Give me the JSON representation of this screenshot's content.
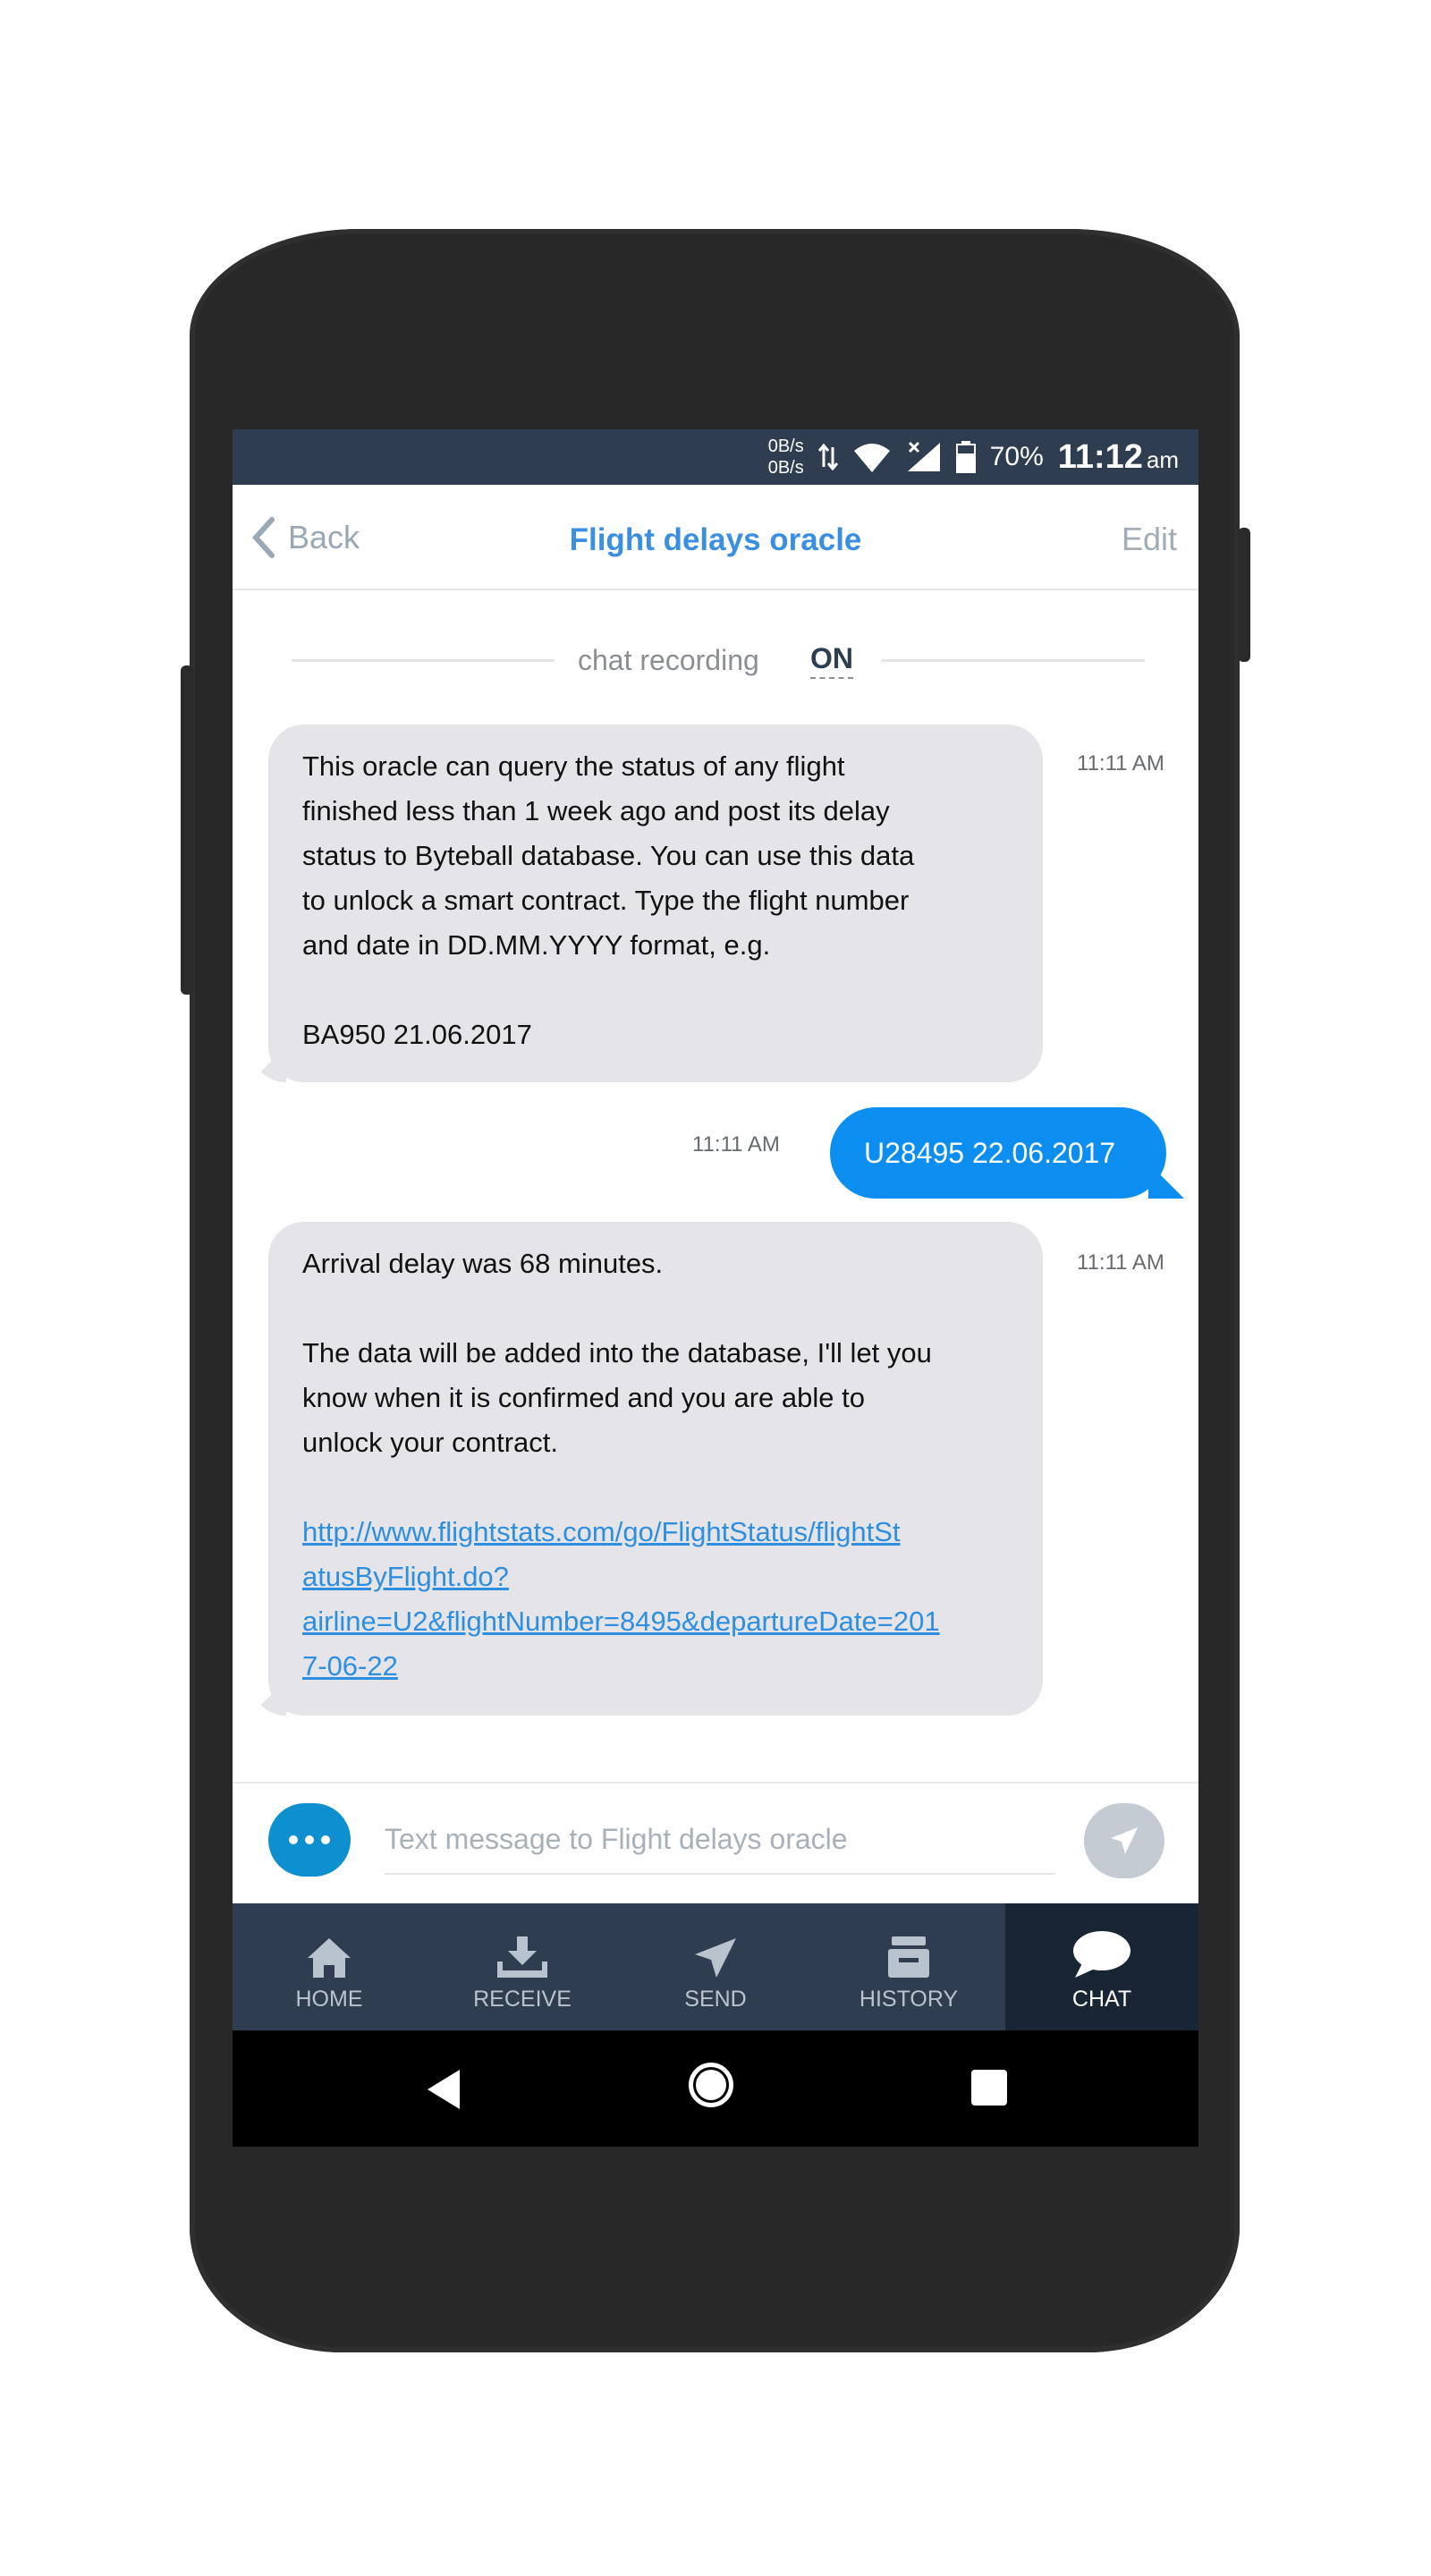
{
  "statusbar": {
    "net_up": "0B/s",
    "net_down": "0B/s",
    "battery": "70%",
    "time": "11:12",
    "ampm": "am",
    "icons": [
      "data-arrows-icon",
      "wifi-icon",
      "signal-icon",
      "battery-icon"
    ]
  },
  "header": {
    "back_label": "Back",
    "title": "Flight delays oracle",
    "edit_label": "Edit"
  },
  "recording": {
    "label": "chat recording",
    "state": "ON"
  },
  "messages": [
    {
      "direction": "in",
      "time": "11:11 AM",
      "lines": [
        "This oracle can query the status of any flight",
        "finished less than 1 week ago and post its delay",
        "status to Byteball database. You can use this data",
        "to unlock a smart contract. Type the flight number",
        "and date in DD.MM.YYYY format, e.g.",
        "",
        "BA950 21.06.2017"
      ]
    },
    {
      "direction": "out",
      "time": "11:11 AM",
      "text": "U28495 22.06.2017"
    },
    {
      "direction": "in",
      "time": "11:11 AM",
      "lines": [
        "Arrival delay was 68 minutes.",
        "",
        "The data will be added into the database, I'll let you",
        "know when it is confirmed and you are able to",
        "unlock your contract."
      ],
      "link_lines": [
        "http://www.flightstats.com/go/FlightStatus/flightSt",
        "atusByFlight.do?",
        "airline=U2&flightNumber=8495&departureDate=201",
        "7-06-22"
      ]
    }
  ],
  "composer": {
    "placeholder": "Text message to Flight delays oracle"
  },
  "tabs": [
    {
      "label": "HOME",
      "icon": "home-icon",
      "active": false
    },
    {
      "label": "RECEIVE",
      "icon": "download-icon",
      "active": false
    },
    {
      "label": "SEND",
      "icon": "paper-plane-icon",
      "active": false
    },
    {
      "label": "HISTORY",
      "icon": "archive-icon",
      "active": false
    },
    {
      "label": "CHAT",
      "icon": "chat-bubble-icon",
      "active": true
    }
  ],
  "colors": {
    "accent": "#3b8fe0",
    "bar": "#2e3e50",
    "outgoing_bubble": "#0b8ef0",
    "incoming_bubble": "#e4e4e9"
  }
}
